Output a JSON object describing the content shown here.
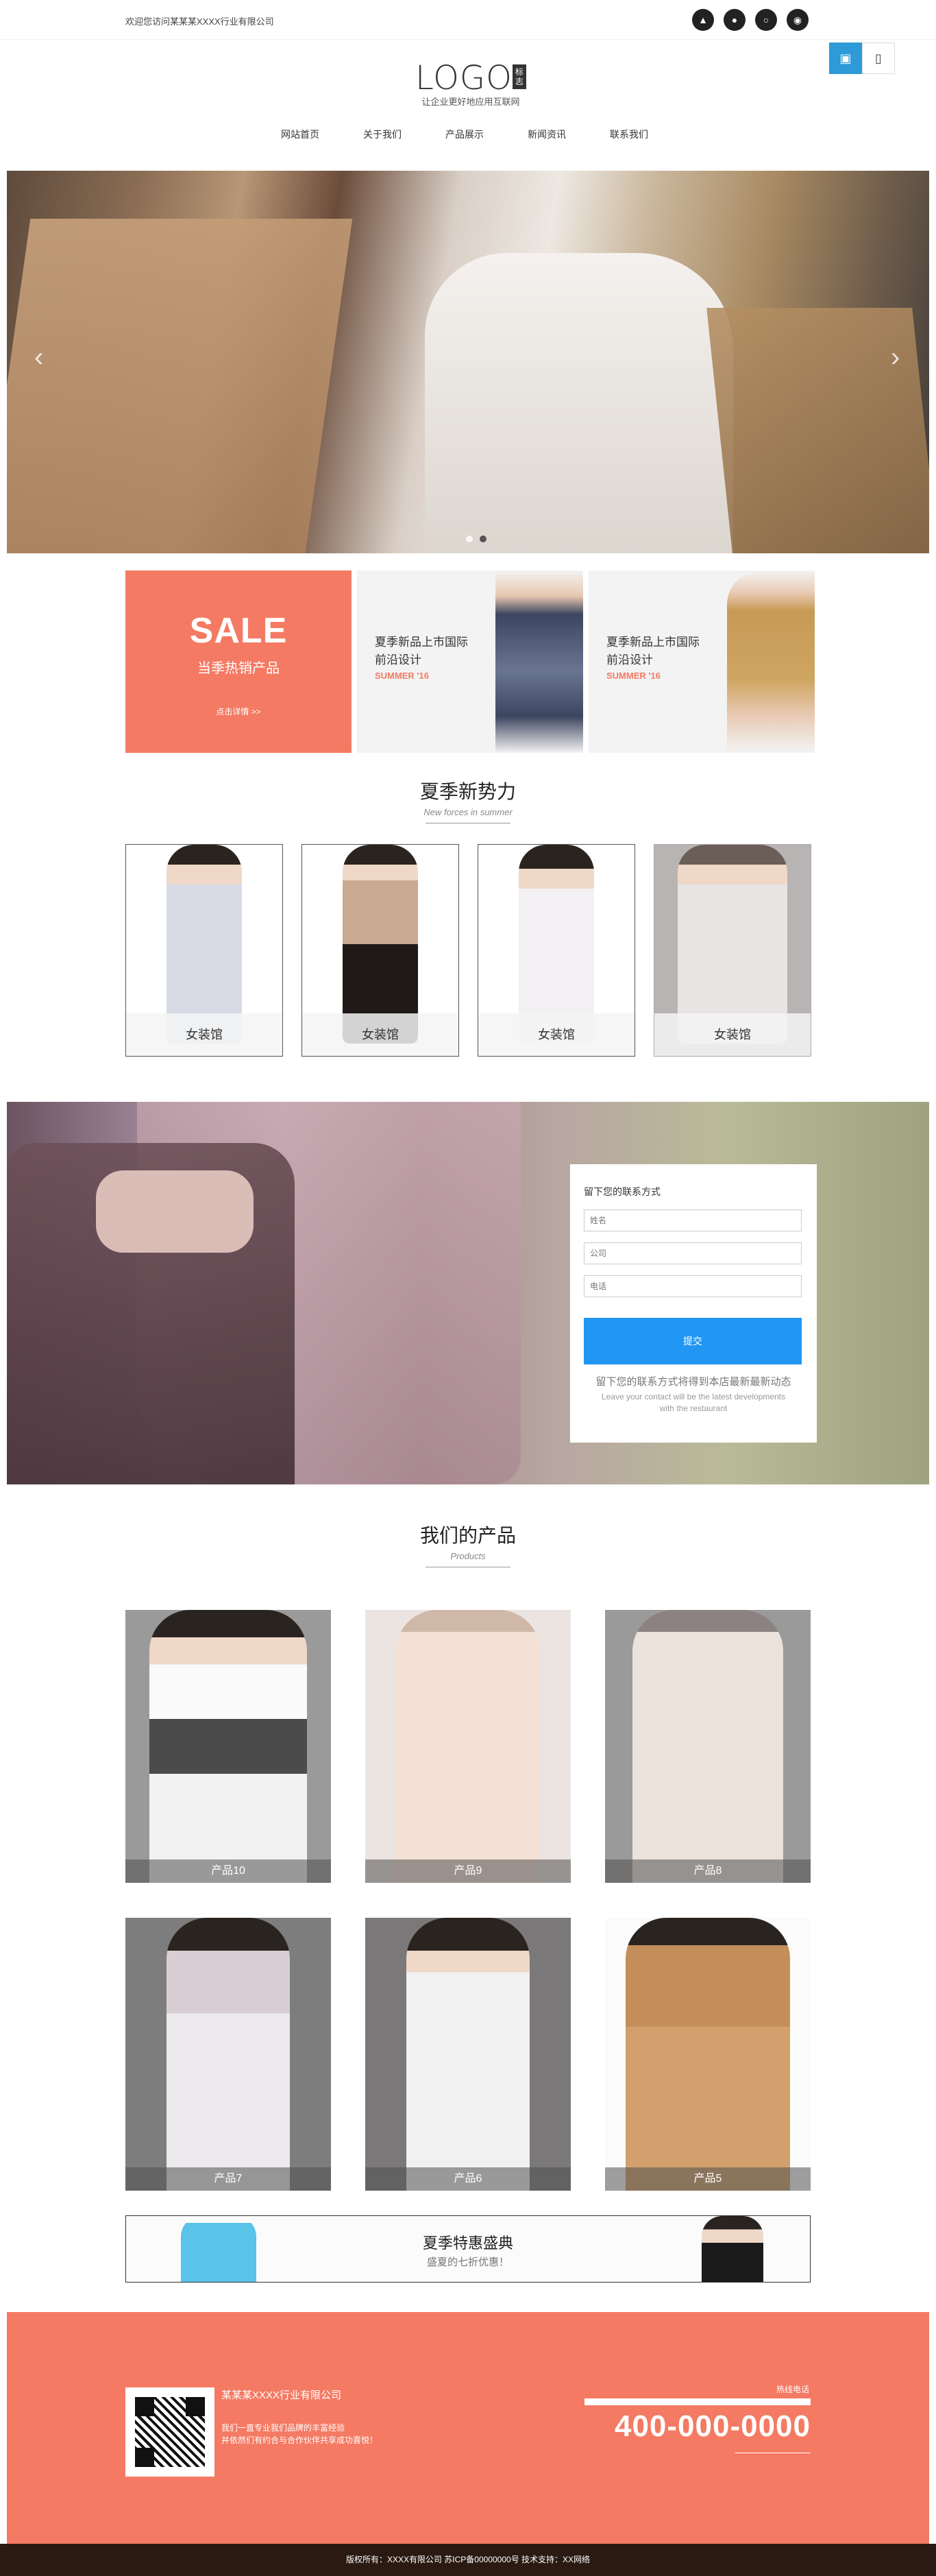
{
  "topbar": {
    "welcome": "欢迎您访问某某某XXXX行业有限公司"
  },
  "social": [
    "android-icon",
    "apple-icon",
    "wechat-icon",
    "weibo-icon"
  ],
  "header": {
    "logo": "LOGO",
    "logo_badge": "标志",
    "slogan": "让企业更好地应用互联网"
  },
  "nav": [
    "网站首页",
    "关于我们",
    "产品展示",
    "新闻资讯",
    "联系我们"
  ],
  "hero": {
    "prev_icon": "‹",
    "next_icon": "›",
    "slides": 2,
    "active_slide": 2
  },
  "promo": {
    "sale_title": "SALE",
    "sale_sub": "当季热销产品",
    "sale_more": "点击详情 >>",
    "cards": [
      {
        "line1": "夏季新品上市国际",
        "line2": "前沿设计",
        "season": "SUMMER  '16"
      },
      {
        "line1": "夏季新品上市国际",
        "line2": "前沿设计",
        "season": "SUMMER  '16"
      }
    ]
  },
  "summer": {
    "title": "夏季新势力",
    "subtitle": "New forces in summer"
  },
  "categories": [
    "女装馆",
    "女装馆",
    "女装馆",
    "女装馆"
  ],
  "contact_form": {
    "title": "留下您的联系方式",
    "name_placeholder": "姓名",
    "company_placeholder": "公司",
    "phone_placeholder": "电话",
    "submit": "提交",
    "note": "留下您的联系方式将得到本店最新最新动态",
    "note_en_1": "Leave your contact will be the latest developments",
    "note_en_2": "with the restaurant"
  },
  "products_section": {
    "title": "我们的产品",
    "subtitle": "Products"
  },
  "products": [
    "产品10",
    "产品9",
    "产品8",
    "产品7",
    "产品6",
    "产品5"
  ],
  "strip": {
    "title": "夏季特惠盛典",
    "sub": "盛夏的七折优惠！"
  },
  "footer": {
    "company": "某某某XXXX行业有限公司",
    "desc_1": "我们一直专业我们品牌的丰富经验",
    "desc_2": "并依然们有约合与合作伙伴共享成功喜悦！",
    "hotline_label": "热线电话",
    "phone": "400-000-0000",
    "copyright": "版权所有：XXXX有限公司   苏ICP备00000000号   技术支持：XX网络"
  },
  "device_switch": [
    "desktop-icon",
    "mobile-icon"
  ],
  "colors": {
    "accent": "#f47a63",
    "submit": "#2196f3",
    "device_active": "#2e9ad7"
  }
}
